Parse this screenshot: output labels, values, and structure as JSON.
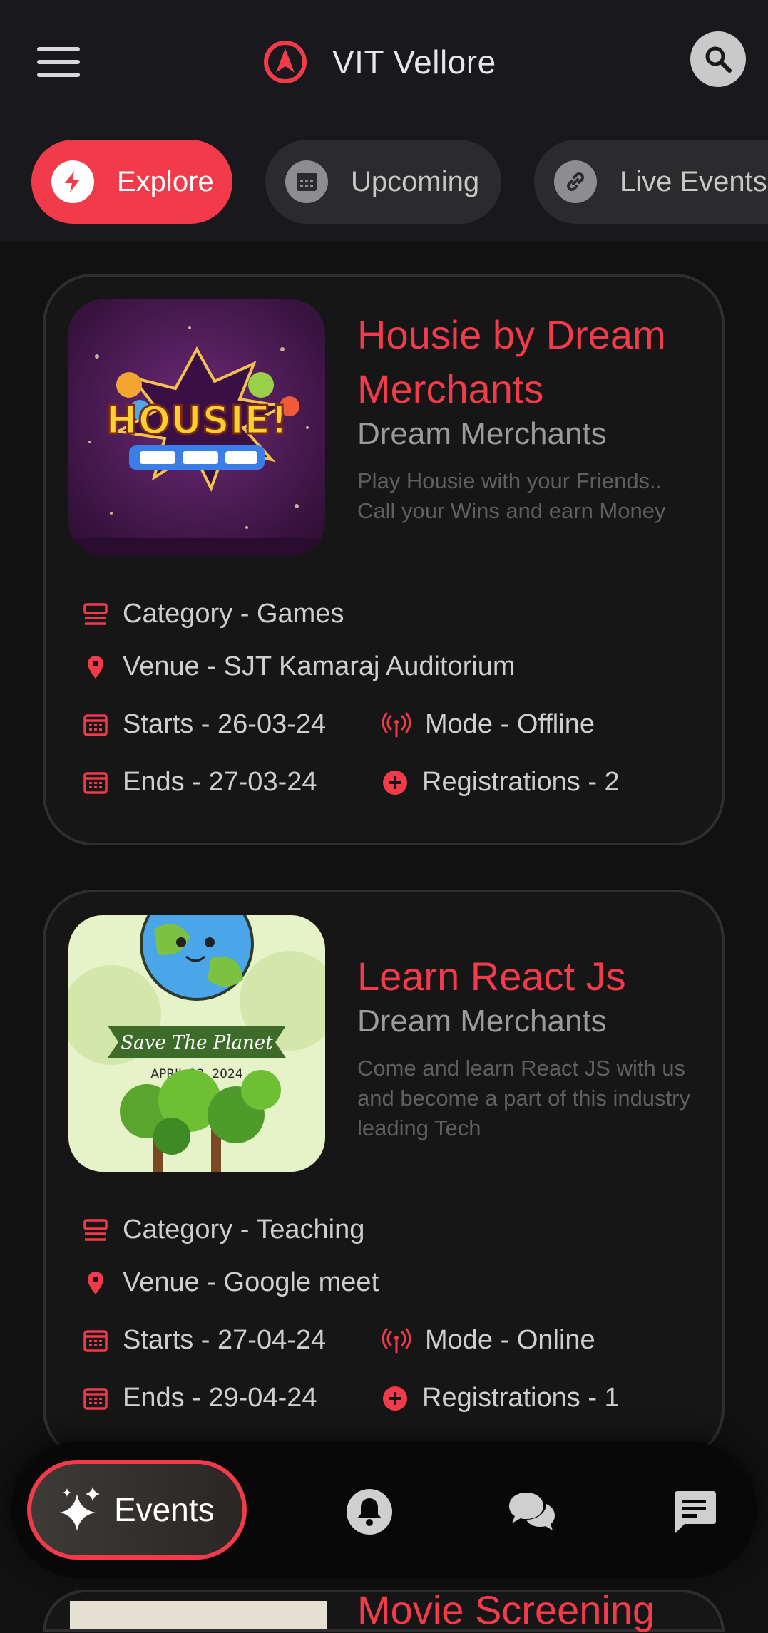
{
  "header": {
    "title": "VIT Vellore",
    "menu_icon": "hamburger-menu-icon",
    "logo_icon": "navigation-arrow-logo-icon",
    "search_icon": "search-icon"
  },
  "tabs": [
    {
      "label": "Explore",
      "icon": "lightning-icon",
      "active": true
    },
    {
      "label": "Upcoming",
      "icon": "calendar-icon",
      "active": false
    },
    {
      "label": "Live Events",
      "icon": "link-icon",
      "active": false
    }
  ],
  "events": [
    {
      "title": "Housie by Dream Merchants",
      "organizer": "Dream Merchants",
      "description": "Play Housie with your Friends.. Call your Wins and earn Money",
      "image": "HOUSIE!",
      "category": "Category - Games",
      "venue": "Venue - SJT Kamaraj Auditorium",
      "starts": "Starts - 26-03-24",
      "ends": "Ends - 27-03-24",
      "mode": "Mode - Offline",
      "registrations": "Registrations - 2"
    },
    {
      "title": "Learn React Js",
      "organizer": "Dream Merchants",
      "description": "Come and learn React JS with us and become a part of this industry leading Tech",
      "image": "Save The Planet",
      "image_date": "APRIL 22, 2024",
      "category": "Category - Teaching",
      "venue": "Venue - Google meet",
      "starts": "Starts - 27-04-24",
      "ends": "Ends - 29-04-24",
      "mode": "Mode - Online",
      "registrations": "Registrations - 1"
    },
    {
      "title": "Movie Screening"
    }
  ],
  "bottom_nav": {
    "events_label": "Events",
    "icons": [
      "sparkles-icon",
      "notification-bell-icon",
      "chat-bubbles-icon",
      "message-icon"
    ]
  },
  "colors": {
    "accent": "#f13a4a",
    "background": "#111112",
    "card": "#161617"
  }
}
